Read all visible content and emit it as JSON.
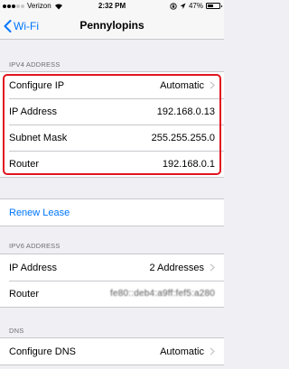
{
  "status_bar": {
    "carrier": "Verizon",
    "time": "2:32 PM",
    "battery": "47%",
    "battery_level": 0.47,
    "signal_bars": 3
  },
  "nav": {
    "back_label": "Wi-Fi",
    "title": "Pennylopins"
  },
  "ipv4": {
    "header": "IPV4 ADDRESS",
    "rows": [
      {
        "label": "Configure IP",
        "value": "Automatic"
      },
      {
        "label": "IP Address",
        "value": "192.168.0.13"
      },
      {
        "label": "Subnet Mask",
        "value": "255.255.255.0"
      },
      {
        "label": "Router",
        "value": "192.168.0.1"
      }
    ]
  },
  "lease": {
    "renew_label": "Renew Lease"
  },
  "ipv6": {
    "header": "IPV6 ADDRESS",
    "rows": [
      {
        "label": "IP Address",
        "value": "2 Addresses"
      },
      {
        "label": "Router",
        "value": "fe80::deb4:a9ff:fef5:a280"
      }
    ]
  },
  "dns": {
    "header": "DNS",
    "rows": [
      {
        "label": "Configure DNS",
        "value": "Automatic"
      }
    ]
  },
  "colors": {
    "accent": "#0076ff",
    "highlight": "#e0141e",
    "background": "#efeff4"
  }
}
